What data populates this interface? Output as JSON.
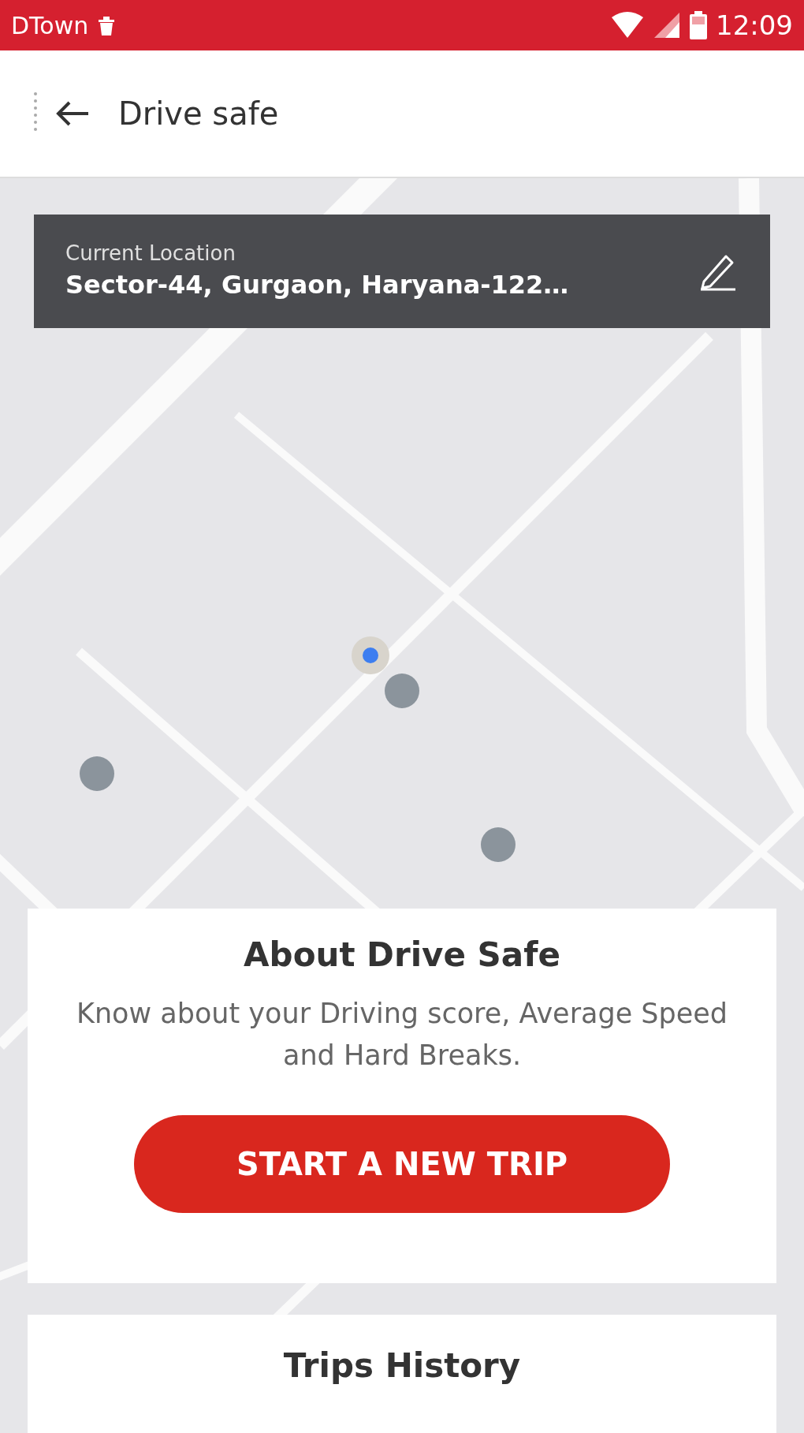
{
  "status_bar": {
    "carrier": "DTown",
    "time": "12:09"
  },
  "header": {
    "title": "Drive safe"
  },
  "location_card": {
    "label": "Current Location",
    "address": "Sector-44, Gurgaon, Haryana-122…"
  },
  "about_card": {
    "title": "About Drive Safe",
    "description": "Know about your Driving score, Average Speed and Hard Breaks.",
    "button": "START A NEW TRIP"
  },
  "history_card": {
    "title": "Trips History"
  }
}
